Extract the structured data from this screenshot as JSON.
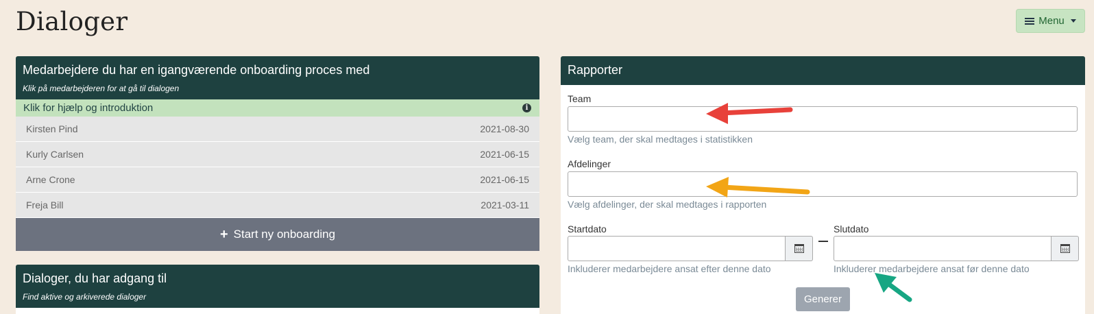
{
  "page": {
    "title": "Dialoger"
  },
  "menu": {
    "label": "Menu"
  },
  "onboarding": {
    "title": "Medarbejdere du har en igangværende onboarding proces med",
    "subtitle": "Klik på medarbejderen for at gå til dialogen",
    "help": "Klik for hjælp og introduktion",
    "employees": [
      {
        "name": "Kirsten Pind",
        "date": "2021-08-30"
      },
      {
        "name": "Kurly Carlsen",
        "date": "2021-06-15"
      },
      {
        "name": "Arne Crone",
        "date": "2021-06-15"
      },
      {
        "name": "Freja Bill",
        "date": "2021-03-11"
      }
    ],
    "start_button": "Start ny onboarding"
  },
  "dialogs": {
    "title": "Dialoger, du har adgang til",
    "subtitle": "Find aktive og arkiverede dialoger"
  },
  "reports": {
    "title": "Rapporter",
    "team_label": "Team",
    "team_value": "",
    "team_hint": "Vælg team, der skal medtages i statistikken",
    "departments_label": "Afdelinger",
    "departments_value": "",
    "departments_hint": "Vælg afdelinger, der skal medtages i rapporten",
    "start_label": "Startdato",
    "start_value": "",
    "start_hint": "Inkluderer medarbejdere ansat efter denne dato",
    "end_label": "Slutdato",
    "end_value": "",
    "end_hint": "Inkluderer medarbejdere ansat før denne dato",
    "generate_button": "Generer"
  },
  "colors": {
    "background": "#f4ebe0",
    "header": "#1e4140",
    "help_row": "#c3e2bd",
    "arrow_red": "#e8413a",
    "arrow_orange": "#f2a516",
    "arrow_green": "#17a683"
  }
}
